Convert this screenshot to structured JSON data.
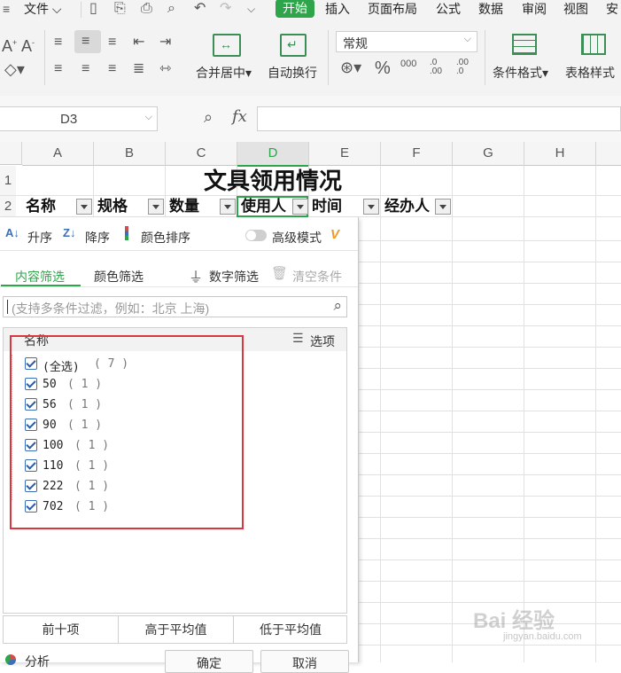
{
  "ribbon": {
    "file_label": "文件",
    "tabs": [
      "开始",
      "插入",
      "页面布局",
      "公式",
      "数据",
      "审阅",
      "视图",
      "安"
    ],
    "merge_label": "合并居中",
    "wrap_label": "自动换行",
    "number_format": "常规",
    "cond_format_label": "条件格式",
    "table_style_label": "表格样式",
    "percent": "%",
    "thousands": "000",
    "inc_decimal": ".0 .00",
    "dec_decimal": ".00 .0",
    "font_a": "A"
  },
  "formula_bar": {
    "cell_ref": "D3",
    "fx": "fx",
    "value": ""
  },
  "sheet": {
    "columns": [
      "A",
      "B",
      "C",
      "D",
      "E",
      "F",
      "G",
      "H"
    ],
    "rows": [
      "1",
      "2"
    ],
    "title": "文具领用情况",
    "headers": [
      "名称",
      "规格",
      "数量",
      "使用人",
      "时间",
      "经办人"
    ]
  },
  "filter": {
    "sort_asc": "升序",
    "sort_desc": "降序",
    "color_sort": "颜色排序",
    "advanced_mode": "高级模式",
    "tab_content": "内容筛选",
    "tab_color": "颜色筛选",
    "number_filter": "数字筛选",
    "clear": "清空条件",
    "search_placeholder": "(支持多条件过滤，例如：北京 上海)",
    "list_header": "名称",
    "options_label": "选项",
    "items": [
      {
        "label": "(全选)",
        "count": "( 7 )"
      },
      {
        "label": "50",
        "count": "( 1 )"
      },
      {
        "label": "56",
        "count": "( 1 )"
      },
      {
        "label": "90",
        "count": "( 1 )"
      },
      {
        "label": "100",
        "count": "( 1 )"
      },
      {
        "label": "110",
        "count": "( 1 )"
      },
      {
        "label": "222",
        "count": "( 1 )"
      },
      {
        "label": "702",
        "count": "( 1 )"
      }
    ],
    "top10": "前十项",
    "above_avg": "高于平均值",
    "below_avg": "低于平均值",
    "analysis": "分析",
    "ok": "确定",
    "cancel": "取消"
  },
  "watermark": {
    "text": "Bai 经验",
    "sub": "jingyan.baidu.com"
  },
  "colors": {
    "accent_green": "#2fa54b",
    "highlight_red": "#d9363e",
    "tab_underline": "#2fa54b"
  }
}
